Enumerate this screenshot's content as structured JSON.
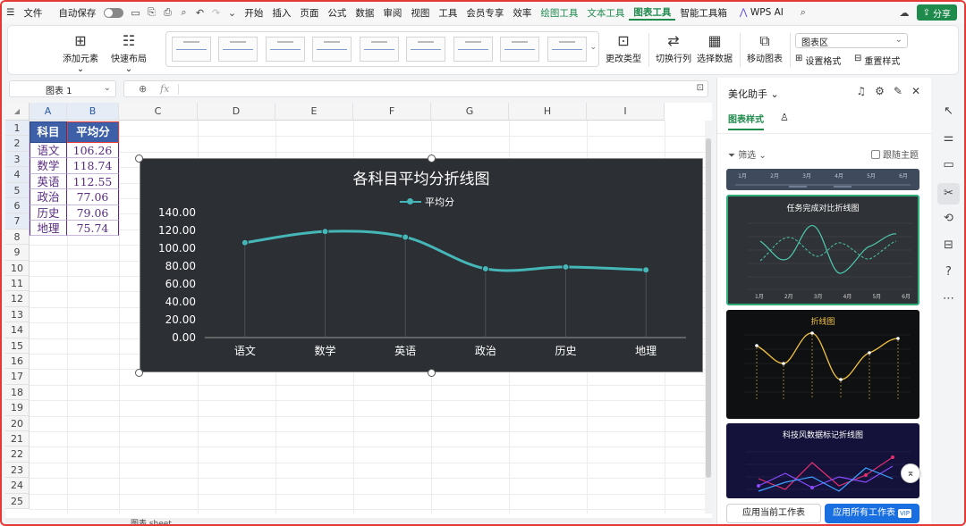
{
  "menubar": {
    "file": "文件",
    "autosave": "自动保存",
    "tabs": [
      "开始",
      "插入",
      "页面",
      "公式",
      "数据",
      "审阅",
      "视图",
      "工具",
      "会员专享",
      "效率"
    ],
    "context_tabs": [
      "绘图工具",
      "文本工具",
      "图表工具"
    ],
    "smart": "智能工具箱",
    "wps_ai": "WPS AI",
    "share": "分享"
  },
  "ribbon": {
    "add_element": "添加元素",
    "quick_layout": "快速布局",
    "change_type": "更改类型",
    "switch_rowcol": "切换行列",
    "select_data": "选择数据",
    "move_chart": "移动图表",
    "chart_area": "图表区",
    "format": "设置格式",
    "reset_style": "重置样式"
  },
  "formula": {
    "namebox": "图表 1",
    "fx": "fx"
  },
  "sheet": {
    "columns": [
      "A",
      "B",
      "C",
      "D",
      "E",
      "F",
      "G",
      "H",
      "I"
    ],
    "rows": [
      "1",
      "2",
      "3",
      "4",
      "5",
      "6",
      "7",
      "8",
      "9",
      "10",
      "11",
      "12",
      "13",
      "14",
      "15",
      "16",
      "17",
      "18",
      "19",
      "20",
      "21",
      "22",
      "23",
      "24",
      "25"
    ],
    "header": [
      "科目",
      "平均分"
    ],
    "data": [
      [
        "语文",
        "106.26"
      ],
      [
        "数学",
        "118.74"
      ],
      [
        "英语",
        "112.55"
      ],
      [
        "政治",
        "77.06"
      ],
      [
        "历史",
        "79.06"
      ],
      [
        "地理",
        "75.74"
      ]
    ],
    "tabs": [
      "图表 sheet"
    ]
  },
  "chart_data": {
    "type": "line",
    "title": "各科目平均分折线图",
    "categories": [
      "语文",
      "数学",
      "英语",
      "政治",
      "历史",
      "地理"
    ],
    "series": [
      {
        "name": "平均分",
        "values": [
          106.26,
          118.74,
          112.55,
          77.06,
          79.06,
          75.74
        ]
      }
    ],
    "yticks": [
      "140.00",
      "120.00",
      "100.00",
      "80.00",
      "60.00",
      "40.00",
      "20.00",
      "0.00"
    ],
    "ylim": [
      0,
      140
    ],
    "smooth": true,
    "legend": "top",
    "colors": {
      "background": "#2c2f33",
      "line": "#46b7b8",
      "text": "#ffffff"
    }
  },
  "panel": {
    "title": "美化助手",
    "tab_style": "图表样式",
    "filter": "筛选",
    "follow_theme": "跟随主题",
    "card1_title": "任务完成对比折线图",
    "card2_title": "折线图",
    "card3_title": "科技风数据标记折线图",
    "card1_months": [
      "1月",
      "2月",
      "3月",
      "4月",
      "5月",
      "6月"
    ],
    "btn_apply_current": "应用当前工作表",
    "btn_apply_all": "应用所有工作表",
    "vip": "VIP"
  }
}
